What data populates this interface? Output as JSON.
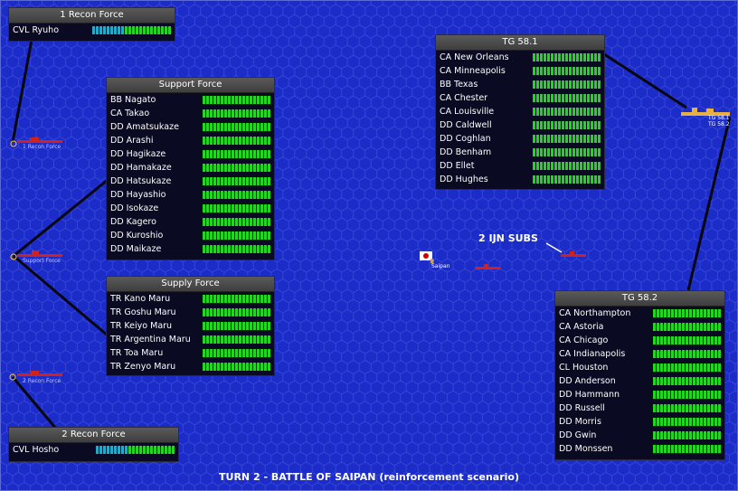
{
  "title": "TURN 2 - BATTLE OF SAIPAN (reinforcement scenario)",
  "colors": {
    "sea": "#1c2cc8",
    "hex_line": "#3645d6",
    "panel_bg": "#0a0a22",
    "bar_green": "#22d622",
    "bar_blue": "#26a8c8",
    "ship_red": "#cc2222"
  },
  "annotation": "2 IJN SUBS",
  "locations": {
    "saipan": {
      "label": "Saipan",
      "flag": "japan-flag"
    }
  },
  "groups": {
    "recon1": {
      "label": "1 Recon Force"
    },
    "support": {
      "label": "Support Force"
    },
    "recon2": {
      "label": "2 Recon Force"
    },
    "tg581": {
      "label": "TG 58.1"
    },
    "tg582": {
      "label": "TG 58.2"
    }
  },
  "panels": {
    "recon1": {
      "header": "1 Recon Force",
      "ships": [
        {
          "name": "CVL Ryuho",
          "blue": 9,
          "green": 13
        }
      ]
    },
    "support": {
      "header": "Support Force",
      "ships": [
        {
          "name": "BB Nagato"
        },
        {
          "name": "CA Takao"
        },
        {
          "name": "DD Amatsukaze"
        },
        {
          "name": "DD Arashi"
        },
        {
          "name": "DD Hagikaze"
        },
        {
          "name": "DD Hamakaze"
        },
        {
          "name": "DD Hatsukaze"
        },
        {
          "name": "DD Hayashio"
        },
        {
          "name": "DD Isokaze"
        },
        {
          "name": "DD Kagero"
        },
        {
          "name": "DD Kuroshio"
        },
        {
          "name": "DD Maikaze"
        }
      ]
    },
    "supply": {
      "header": "Supply Force",
      "ships": [
        {
          "name": "TR Kano Maru"
        },
        {
          "name": "TR Goshu Maru"
        },
        {
          "name": "TR Keiyo Maru"
        },
        {
          "name": "TR Argentina Maru"
        },
        {
          "name": "TR Toa Maru"
        },
        {
          "name": "TR Zenyo Maru"
        }
      ]
    },
    "recon2": {
      "header": "2 Recon Force",
      "ships": [
        {
          "name": "CVL Hosho",
          "blue": 9,
          "green": 13
        }
      ]
    },
    "tg581": {
      "header": "TG 58.1",
      "ships": [
        {
          "name": "CA New Orleans"
        },
        {
          "name": "CA Minneapolis"
        },
        {
          "name": "BB Texas"
        },
        {
          "name": "CA Chester"
        },
        {
          "name": "CA Louisville"
        },
        {
          "name": "DD Caldwell"
        },
        {
          "name": "DD Coghlan"
        },
        {
          "name": "DD Benham"
        },
        {
          "name": "DD Ellet"
        },
        {
          "name": "DD Hughes"
        }
      ]
    },
    "tg582": {
      "header": "TG 58.2",
      "ships": [
        {
          "name": "CA Northampton"
        },
        {
          "name": "CA Astoria"
        },
        {
          "name": "CA Chicago"
        },
        {
          "name": "CA Indianapolis"
        },
        {
          "name": "CL Houston"
        },
        {
          "name": "DD Anderson"
        },
        {
          "name": "DD Hammann"
        },
        {
          "name": "DD Russell"
        },
        {
          "name": "DD Morris"
        },
        {
          "name": "DD Gwin"
        },
        {
          "name": "DD Monssen"
        }
      ]
    }
  }
}
